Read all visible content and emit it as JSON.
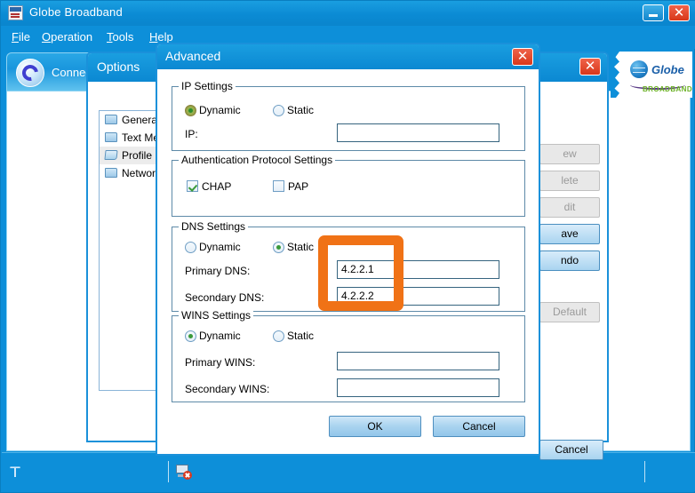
{
  "app": {
    "title": "Globe Broadband",
    "icon": "app-icon",
    "window_buttons": {
      "minimize": "minimize-icon",
      "close": "close-icon"
    },
    "menu": [
      {
        "label": "File",
        "accel": "F"
      },
      {
        "label": "Operation",
        "accel": "O"
      },
      {
        "label": "Tools",
        "accel": "T"
      },
      {
        "label": "Help",
        "accel": "H"
      }
    ],
    "tab": {
      "label": "Connection",
      "icon": "sync-circle-icon"
    },
    "logo": {
      "brand": "Globe",
      "sub": "BROADBAND",
      "icon": "globe-icon"
    },
    "status_bar": {
      "signal_icon": "antenna-icon",
      "connection_icon": "computer-disconnected-icon"
    }
  },
  "options_window": {
    "title": "Options",
    "close_icon": "close-icon",
    "tree": [
      {
        "label": "General",
        "icon": "folder-closed-icon",
        "selected": false
      },
      {
        "label": "Text Mes",
        "icon": "folder-closed-icon",
        "selected": false
      },
      {
        "label": "Profile M",
        "icon": "folder-open-icon",
        "selected": true
      },
      {
        "label": "Network",
        "icon": "folder-closed-icon",
        "selected": false
      }
    ],
    "buttons": [
      {
        "label": "ew",
        "full": "New",
        "state": "disabled"
      },
      {
        "label": "lete",
        "full": "Delete",
        "state": "disabled"
      },
      {
        "label": "dit",
        "full": "Edit",
        "state": "disabled"
      },
      {
        "label": "ave",
        "full": "Save",
        "state": "enabled"
      },
      {
        "label": "ndo",
        "full": "Undo",
        "state": "enabled"
      },
      {
        "label": "Default",
        "full": "Default",
        "state": "disabled"
      }
    ],
    "cancel_label": "Cancel"
  },
  "advanced_dialog": {
    "title": "Advanced",
    "close_icon": "close-icon",
    "ip_settings": {
      "legend": "IP Settings",
      "dynamic_label": "Dynamic",
      "static_label": "Static",
      "selected": "Dynamic",
      "ip_label": "IP:",
      "ip_value": "",
      "ip_placeholder": ""
    },
    "auth_settings": {
      "legend": "Authentication Protocol Settings",
      "chap_label": "CHAP",
      "chap_checked": true,
      "pap_label": "PAP",
      "pap_checked": false
    },
    "dns_settings": {
      "legend": "DNS Settings",
      "dynamic_label": "Dynamic",
      "static_label": "Static",
      "selected": "Static",
      "primary_label": "Primary DNS:",
      "primary_value": "4.2.2.1",
      "secondary_label": "Secondary DNS:",
      "secondary_value": "4.2.2.2"
    },
    "wins_settings": {
      "legend": "WINS Settings",
      "dynamic_label": "Dynamic",
      "static_label": "Static",
      "selected": "Dynamic",
      "primary_label": "Primary WINS:",
      "primary_value": "",
      "secondary_label": "Secondary WINS:",
      "secondary_value": ""
    },
    "ok_label": "OK",
    "cancel_label": "Cancel"
  },
  "annotation": {
    "color": "#f07216",
    "target": "dns-server-fields"
  }
}
